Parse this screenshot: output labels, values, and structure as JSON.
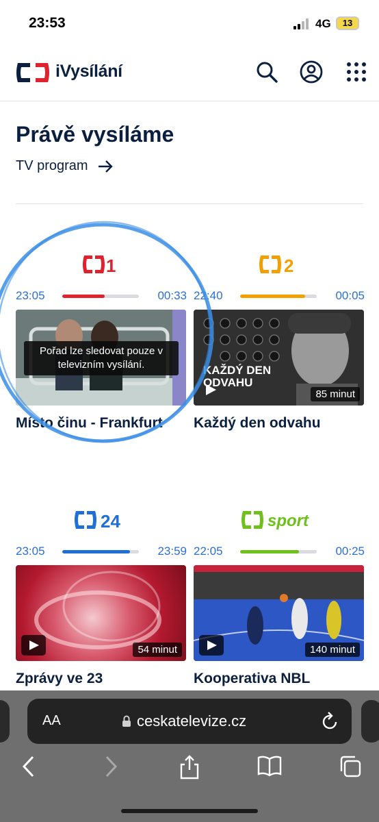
{
  "status": {
    "time": "23:53",
    "network": "4G",
    "battery": "13"
  },
  "header": {
    "brand": "iVysílání",
    "icons": [
      "search-icon",
      "profile-icon",
      "apps-grid-icon"
    ]
  },
  "page": {
    "title": "Právě vysíláme",
    "tv_program_link": "TV program"
  },
  "channels": [
    {
      "name": "ČT1",
      "logo_text": "1",
      "color": "#e0222f",
      "start": "23:05",
      "end": "00:33",
      "progress": 0.55,
      "show": "Místo činu - Frankfurt",
      "notice": "Pořad lze sledovat pouze v televizním vysílání."
    },
    {
      "name": "ČT2",
      "logo_text": "2",
      "color": "#f2a000",
      "start": "22:40",
      "end": "00:05",
      "progress": 0.85,
      "show": "Každý den odvahu",
      "duration": "85 minut",
      "thumb_caption": "KAŽDÝ DEN ODVAHU"
    },
    {
      "name": "ČT24",
      "logo_text": "24",
      "color": "#1f6fd6",
      "start": "23:05",
      "end": "23:59",
      "progress": 0.88,
      "show": "Zprávy ve 23",
      "duration": "54 minut"
    },
    {
      "name": "ČT sport",
      "logo_text": "sport",
      "color": "#6ec01b",
      "start": "22:05",
      "end": "00:25",
      "progress": 0.77,
      "show": "Kooperativa NBL",
      "duration": "140 minut"
    }
  ],
  "browser": {
    "aa_label": "AA",
    "url": "ceskatelevize.cz",
    "toolbar": [
      "back-icon",
      "forward-icon",
      "share-icon",
      "bookmarks-icon",
      "tabs-icon"
    ]
  }
}
